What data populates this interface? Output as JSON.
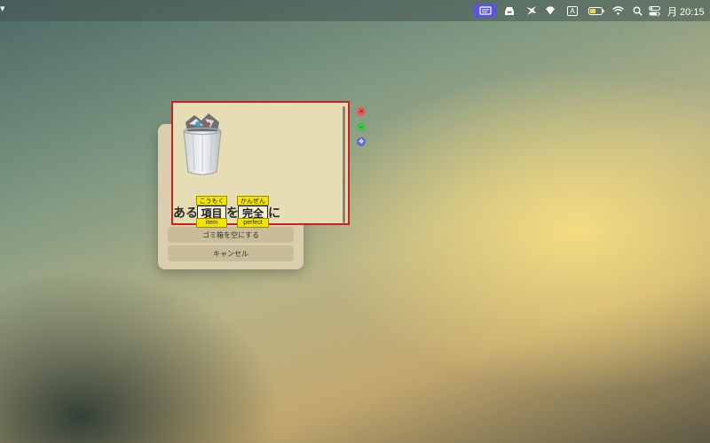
{
  "menubar": {
    "clock": "月 20:15",
    "icons": [
      "app-menu-icon",
      "inbox-icon",
      "bird-icon",
      "diamond-icon",
      "input-source-icon",
      "battery-icon",
      "wifi-icon",
      "search-icon",
      "control-center-icon"
    ],
    "input_source_label": "A"
  },
  "dialog": {
    "empty_trash_label": "ゴミ箱を空にする",
    "cancel_label": "キャンセル"
  },
  "reader": {
    "prefix": "ある",
    "particle": "を",
    "suffix": "に",
    "words": [
      {
        "text": "項目",
        "reading": "こうもく",
        "gloss": "item"
      },
      {
        "text": "完全",
        "reading": "かんぜん",
        "gloss": "perfect"
      }
    ]
  },
  "colors": {
    "panel_border": "#cc1f1f",
    "annotation_yellow": "#f5e400",
    "menu_active": "#5a56d6"
  }
}
